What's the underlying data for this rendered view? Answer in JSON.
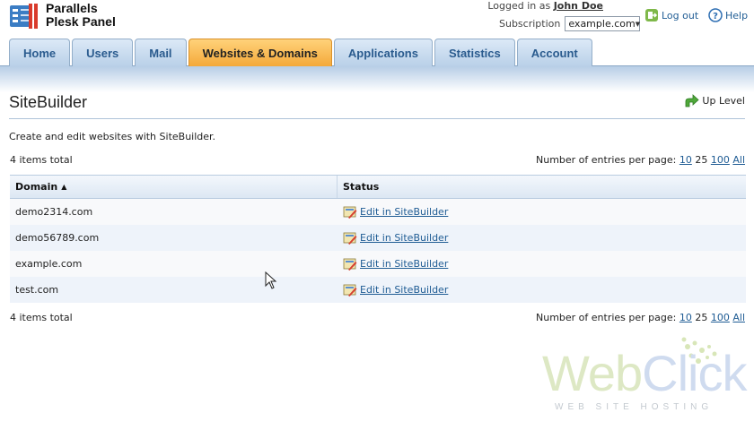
{
  "header": {
    "product_name_line1": "Parallels",
    "product_name_line2": "Plesk Panel",
    "logged_in_label": "Logged in as",
    "user_name": "John Doe",
    "subscription_label": "Subscription",
    "subscription_value": "example.com",
    "logout_label": "Log out",
    "help_label": "Help"
  },
  "tabs": [
    {
      "label": "Home"
    },
    {
      "label": "Users"
    },
    {
      "label": "Mail"
    },
    {
      "label": "Websites & Domains",
      "active": true
    },
    {
      "label": "Applications"
    },
    {
      "label": "Statistics"
    },
    {
      "label": "Account"
    }
  ],
  "page": {
    "title": "SiteBuilder",
    "up_level_label": "Up Level",
    "description": "Create and edit websites with SiteBuilder.",
    "items_total": "4 items total",
    "entries_label": "Number of entries per page:",
    "entries_options": [
      "10",
      "25",
      "100",
      "All"
    ],
    "entries_current": "25"
  },
  "table": {
    "columns": [
      "Domain",
      "Status"
    ],
    "rows": [
      {
        "domain": "demo2314.com",
        "status": "Edit in SiteBuilder"
      },
      {
        "domain": "demo56789.com",
        "status": "Edit in SiteBuilder"
      },
      {
        "domain": "example.com",
        "status": "Edit in SiteBuilder"
      },
      {
        "domain": "test.com",
        "status": "Edit in SiteBuilder"
      }
    ]
  },
  "watermark": {
    "brand_part1": "Web",
    "brand_part2": "Click",
    "tagline": "WEB SITE HOSTING"
  },
  "colors": {
    "accent_tab": "#f4a93a",
    "tab": "#b9d0e8",
    "link": "#1f5c94"
  },
  "icons": {
    "logo": "plesk-logo-icon",
    "logout": "logout-icon",
    "help": "help-icon",
    "up_level": "up-arrow-icon",
    "edit": "edit-sitebuilder-icon",
    "sort": "sort-ascending-icon"
  }
}
